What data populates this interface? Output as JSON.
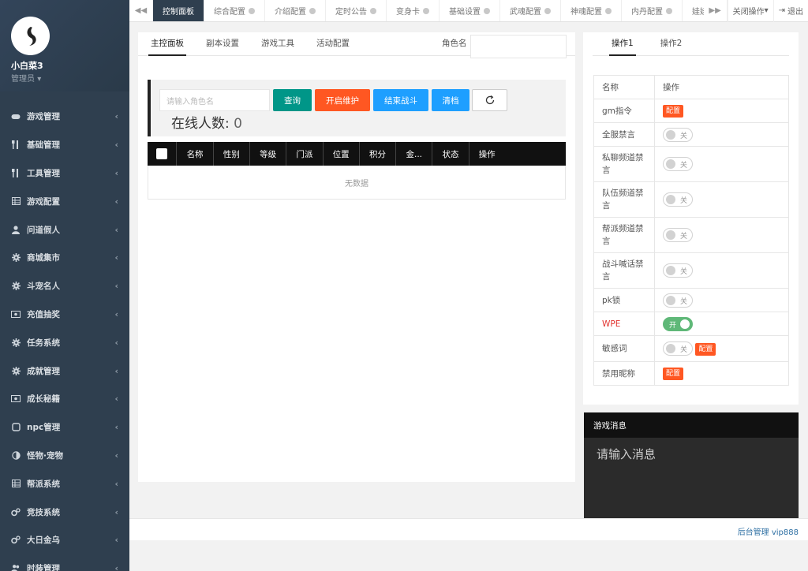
{
  "sidebar": {
    "user_name": "小白菜3",
    "user_role": "管理员",
    "items": [
      {
        "label": "游戏管理",
        "icon": "gamepad-icon"
      },
      {
        "label": "基础管理",
        "icon": "cutlery-icon"
      },
      {
        "label": "工具管理",
        "icon": "cutlery-icon"
      },
      {
        "label": "游戏配置",
        "icon": "table-icon"
      },
      {
        "label": "问道假人",
        "icon": "user-icon"
      },
      {
        "label": "商城集市",
        "icon": "gear-icon"
      },
      {
        "label": "斗宠名人",
        "icon": "gear-icon"
      },
      {
        "label": "充值抽奖",
        "icon": "money-icon"
      },
      {
        "label": "任务系统",
        "icon": "gear-icon"
      },
      {
        "label": "成就管理",
        "icon": "gear-icon"
      },
      {
        "label": "成长秘籍",
        "icon": "money-icon"
      },
      {
        "label": "npc管理",
        "icon": "square-icon"
      },
      {
        "label": "怪物·宠物",
        "icon": "contrast-icon"
      },
      {
        "label": "帮派系统",
        "icon": "table-icon"
      },
      {
        "label": "竞技系统",
        "icon": "gears-icon"
      },
      {
        "label": "大日金乌",
        "icon": "gears-icon"
      },
      {
        "label": "时装管理",
        "icon": "users-icon"
      }
    ]
  },
  "topbar": {
    "tabs": [
      {
        "label": "控制面板",
        "active": true,
        "closable": false
      },
      {
        "label": "综合配置",
        "active": false,
        "closable": true
      },
      {
        "label": "介绍配置",
        "active": false,
        "closable": true
      },
      {
        "label": "定时公告",
        "active": false,
        "closable": true
      },
      {
        "label": "变身卡",
        "active": false,
        "closable": true
      },
      {
        "label": "基础设置",
        "active": false,
        "closable": true
      },
      {
        "label": "武魂配置",
        "active": false,
        "closable": true
      },
      {
        "label": "神魂配置",
        "active": false,
        "closable": true
      },
      {
        "label": "内丹配置",
        "active": false,
        "closable": true
      },
      {
        "label": "娃娃配",
        "active": false,
        "closable": false
      }
    ],
    "close_ops": "关闭操作",
    "logout": "退出"
  },
  "main": {
    "tabs": [
      "主控面板",
      "副本设置",
      "游戏工具",
      "活动配置"
    ],
    "role_label": "角色名",
    "search_placeholder": "请输入角色名",
    "buttons": {
      "query": "查询",
      "maintenance": "开启维护",
      "end_battle": "结束战斗",
      "clear": "清档"
    },
    "online_label": "在线人数:",
    "online_count": "0",
    "columns": [
      "名称",
      "性别",
      "等级",
      "门派",
      "位置",
      "积分",
      "金...",
      "状态",
      "操作"
    ],
    "empty": "无数据"
  },
  "ops": {
    "tabs": [
      "操作1",
      "操作2"
    ],
    "header": {
      "name": "名称",
      "action": "操作"
    },
    "config_label": "配置",
    "on_label": "开",
    "off_label": "关",
    "rows": [
      {
        "name": "gm指令",
        "type": "config"
      },
      {
        "name": "全服禁言",
        "type": "switch",
        "on": false
      },
      {
        "name": "私聊频道禁言",
        "type": "switch",
        "on": false
      },
      {
        "name": "队伍频道禁言",
        "type": "switch",
        "on": false
      },
      {
        "name": "帮派频道禁言",
        "type": "switch",
        "on": false
      },
      {
        "name": "战斗喊话禁言",
        "type": "switch",
        "on": false
      },
      {
        "name": "pk锁",
        "type": "switch",
        "on": false
      },
      {
        "name": "WPE",
        "type": "switch",
        "on": true,
        "highlight": true
      },
      {
        "name": "敏感词",
        "type": "switch+config",
        "on": false
      },
      {
        "name": "禁用昵称",
        "type": "config"
      }
    ]
  },
  "message": {
    "title": "游戏消息",
    "placeholder": "请输入消息"
  },
  "footer": {
    "text": "后台管理 vip888"
  },
  "colors": {
    "sidebar": "#2f3f4f",
    "teal": "#009688",
    "orange": "#ff5722",
    "blue": "#1e9fff",
    "green": "#5fb878"
  }
}
